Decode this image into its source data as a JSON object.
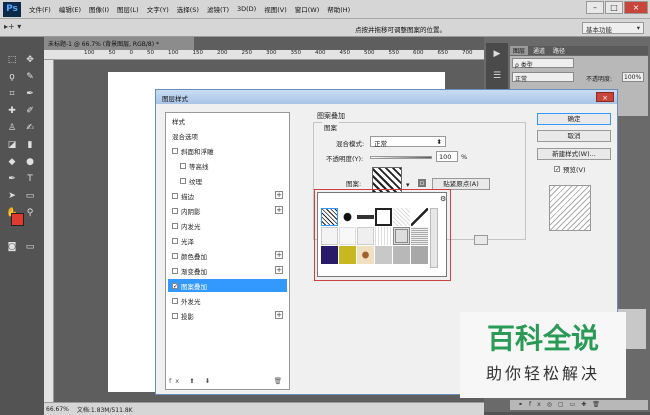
{
  "menubar": {
    "items": [
      "文件(F)",
      "编辑(E)",
      "图像(I)",
      "图层(L)",
      "文字(Y)",
      "选择(S)",
      "滤镜(T)",
      "3D(D)",
      "视图(V)",
      "窗口(W)",
      "帮助(H)"
    ]
  },
  "options": {
    "hint": "点按并拖移可调整图案的位置。",
    "workspace": "基本功能"
  },
  "document": {
    "tab": "未标题-1 @ 66.7% (背景图层, RGB/8) *",
    "zoom": "66.67%",
    "docinfo": "文档:1.83M/511.8K"
  },
  "ruler": {
    "labels": [
      "100",
      "50",
      "0",
      "50",
      "100",
      "150",
      "200",
      "250",
      "300",
      "350",
      "400",
      "450",
      "500",
      "550",
      "600",
      "650",
      "700"
    ]
  },
  "panel": {
    "tabs": [
      "图层",
      "通道",
      "路径"
    ],
    "kind": "ρ 类型",
    "blend": "正常",
    "opacity_label": "不透明度:",
    "opacity_value": "100%"
  },
  "dialog": {
    "title": "图层样式",
    "styles_header": "样式",
    "items": [
      {
        "label": "混合选项",
        "checkbox": false,
        "plus": false,
        "sub": false
      },
      {
        "label": "斜面和浮雕",
        "checkbox": true,
        "plus": false,
        "sub": false
      },
      {
        "label": "等高线",
        "checkbox": true,
        "plus": false,
        "sub": true
      },
      {
        "label": "纹理",
        "checkbox": true,
        "plus": false,
        "sub": true
      },
      {
        "label": "描边",
        "checkbox": true,
        "plus": true,
        "sub": false
      },
      {
        "label": "内阴影",
        "checkbox": true,
        "plus": true,
        "sub": false
      },
      {
        "label": "内发光",
        "checkbox": true,
        "plus": false,
        "sub": false
      },
      {
        "label": "光泽",
        "checkbox": true,
        "plus": false,
        "sub": false
      },
      {
        "label": "颜色叠加",
        "checkbox": true,
        "plus": true,
        "sub": false
      },
      {
        "label": "渐变叠加",
        "checkbox": true,
        "plus": true,
        "sub": false
      },
      {
        "label": "图案叠加",
        "checkbox": true,
        "plus": false,
        "sub": false,
        "selected": true
      },
      {
        "label": "外发光",
        "checkbox": true,
        "plus": false,
        "sub": false
      },
      {
        "label": "投影",
        "checkbox": true,
        "plus": true,
        "sub": false
      }
    ],
    "section_title": "图案叠加",
    "group_title": "图案",
    "blend_label": "混合模式:",
    "blend_value": "正常",
    "opacity_label": "不透明度(Y):",
    "opacity_value": "100",
    "percent": "%",
    "pattern_label": "图案:",
    "snap_button": "贴紧原点(A)",
    "ok": "确定",
    "cancel": "取消",
    "new_style": "新建样式(W)...",
    "preview": "预览(V)"
  },
  "watermark": {
    "title": "百科全说",
    "subtitle": "助你轻松解决"
  }
}
